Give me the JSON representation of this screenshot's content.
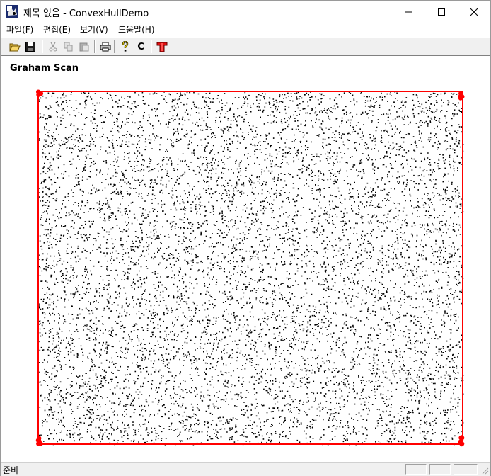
{
  "window": {
    "title": "제목 없음 - ConvexHullDemo",
    "icon": "app-icon"
  },
  "menu": {
    "file": "파일(F)",
    "edit": "편집(E)",
    "view": "보기(V)",
    "help": "도움말(H)"
  },
  "toolbar": {
    "buttons": [
      {
        "name": "open-icon"
      },
      {
        "name": "save-icon"
      },
      {
        "name": "cut-icon"
      },
      {
        "name": "copy-icon"
      },
      {
        "name": "paste-icon"
      },
      {
        "name": "print-icon"
      },
      {
        "name": "help-icon"
      },
      {
        "name": "c-button",
        "label": "C"
      },
      {
        "name": "convex-hull-icon"
      }
    ]
  },
  "canvas": {
    "algorithm_title": "Graham Scan",
    "point_color": "#000000",
    "hull_color": "#ff0000",
    "background": "#ffffff"
  },
  "status": {
    "text": "준비"
  }
}
